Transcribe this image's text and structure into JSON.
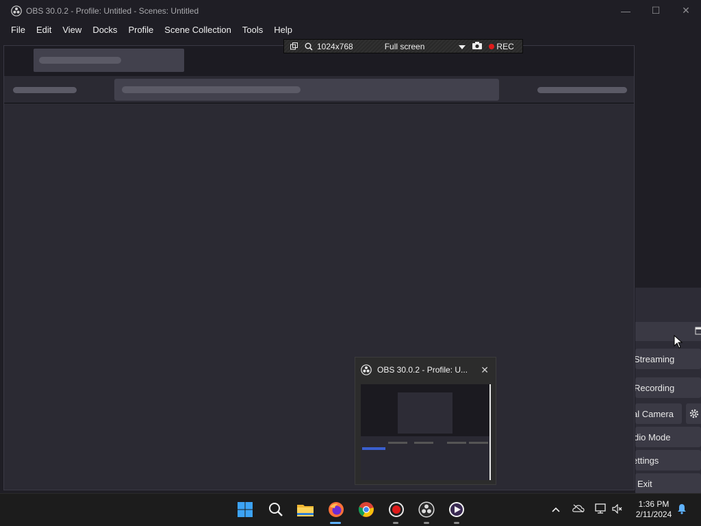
{
  "window": {
    "title": "OBS 30.0.2 - Profile: Untitled - Scenes: Untitled",
    "minimize": "—",
    "maximize": "☐",
    "close": "✕"
  },
  "menu": [
    "File",
    "Edit",
    "View",
    "Docks",
    "Profile",
    "Scene Collection",
    "Tools",
    "Help"
  ],
  "recorder_toolbar": {
    "resolution": "1024x768",
    "mode": "Full screen",
    "rec_label": "REC"
  },
  "dock_buttons": {
    "streaming": "Streaming",
    "recording": "Recording",
    "virtual_camera": "al Camera",
    "studio_mode": "dio Mode",
    "settings": "ettings",
    "exit": "Exit"
  },
  "thumbnail": {
    "title": "OBS 30.0.2 - Profile: U...",
    "close": "✕"
  },
  "taskbar": {
    "time": "1:36 PM",
    "date": "2/11/2024"
  },
  "colors": {
    "rec_red": "#e01b1b",
    "taskbar_bg": "#1c1c1c",
    "obs_bg": "#1f1e25"
  }
}
